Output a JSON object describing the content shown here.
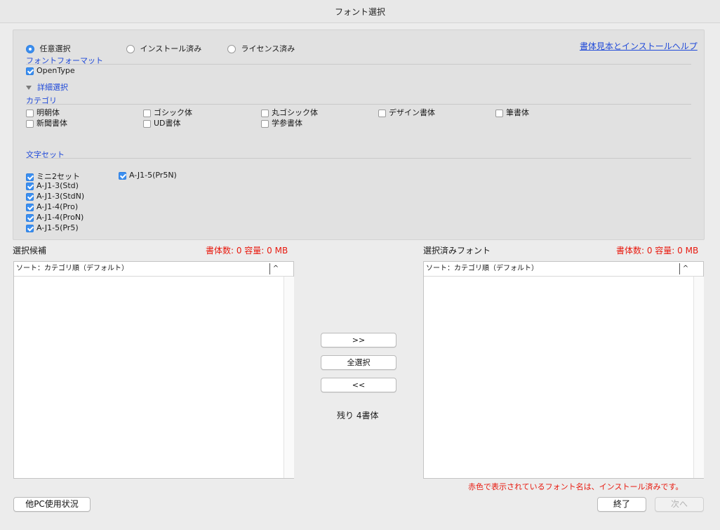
{
  "window": {
    "title": "フォント選択"
  },
  "filter": {
    "radio_options": [
      {
        "label": "任意選択",
        "selected": true
      },
      {
        "label": "インストール済み",
        "selected": false
      },
      {
        "label": "ライセンス済み",
        "selected": false
      }
    ],
    "help_link": "書体見本とインストールヘルプ",
    "font_format": {
      "title": "フォントフォーマット",
      "options": [
        {
          "label": "OpenType",
          "checked": true
        }
      ]
    },
    "detail_toggle": "詳細選択",
    "category": {
      "title": "カテゴリ",
      "options": [
        {
          "label": "明朝体",
          "checked": false
        },
        {
          "label": "ゴシック体",
          "checked": false
        },
        {
          "label": "丸ゴシック体",
          "checked": false
        },
        {
          "label": "デザイン書体",
          "checked": false
        },
        {
          "label": "筆書体",
          "checked": false
        },
        {
          "label": "新聞書体",
          "checked": false
        },
        {
          "label": "UD書体",
          "checked": false
        },
        {
          "label": "学参書体",
          "checked": false
        }
      ]
    },
    "charset": {
      "title": "文字セット",
      "options": [
        {
          "label": "ミニ2セット",
          "checked": true
        },
        {
          "label": "A-J1-5(Pr5N)",
          "checked": true
        },
        {
          "label": "A-J1-3(Std)",
          "checked": true
        },
        {
          "label": "A-J1-3(StdN)",
          "checked": true
        },
        {
          "label": "A-J1-4(Pro)",
          "checked": true
        },
        {
          "label": "A-J1-4(ProN)",
          "checked": true
        },
        {
          "label": "A-J1-5(Pr5)",
          "checked": true
        }
      ]
    }
  },
  "candidates": {
    "title": "選択候補",
    "stats": "書体数: 0 容量: 0 MB",
    "sort_label": "ソート：カテゴリ順（デフォルト）",
    "sort_icon": "^"
  },
  "selected": {
    "title": "選択済みフォント",
    "stats": "書体数: 0 容量: 0 MB",
    "sort_label": "ソート：カテゴリ順（デフォルト）",
    "sort_icon": "^"
  },
  "transfer": {
    "add_label": ">>",
    "select_all_label": "全選択",
    "remove_label": "<<",
    "remaining": "残り 4書体"
  },
  "note": "赤色で表示されているフォント名は、インストール済みです。",
  "footer": {
    "other_pc_label": "他PC使用状況",
    "finish_label": "終了",
    "next_label": "次へ"
  },
  "colors": {
    "accent": "#3b8ff0",
    "link": "#1f49d8",
    "warning": "#e8190e"
  }
}
